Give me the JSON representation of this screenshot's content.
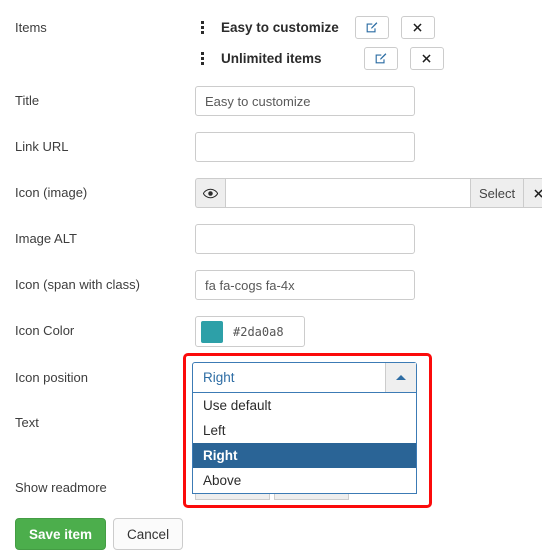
{
  "form": {
    "items": {
      "label": "Items",
      "rows": [
        {
          "title": "Easy to customize",
          "edit_icon": "pencil-square-icon",
          "delete_icon": "close-x-icon",
          "drag_icon": "drag-handle-icon"
        },
        {
          "title": "Unlimited items",
          "edit_icon": "pencil-square-icon",
          "delete_icon": "close-x-icon",
          "drag_icon": "drag-handle-icon"
        }
      ]
    },
    "title": {
      "label": "Title",
      "value": "Easy to customize",
      "placeholder": ""
    },
    "link_url": {
      "label": "Link URL",
      "value": "",
      "placeholder": ""
    },
    "icon_image": {
      "label": "Icon (image)",
      "value": "",
      "placeholder": "",
      "preview_icon": "eye-icon",
      "select_label": "Select",
      "clear_icon": "close-x-icon"
    },
    "image_alt": {
      "label": "Image ALT",
      "value": "",
      "placeholder": ""
    },
    "icon_span": {
      "label": "Icon (span with class)",
      "value": "fa fa-cogs fa-4x",
      "placeholder": ""
    },
    "icon_color": {
      "label": "Icon Color",
      "value": "#2da0a8",
      "swatch": "#2da0a8"
    },
    "icon_position": {
      "label": "Icon position",
      "selected": "Right",
      "toggle_icon": "caret-up-icon",
      "options": [
        {
          "label": "Use default",
          "selected": false
        },
        {
          "label": "Left",
          "selected": false
        },
        {
          "label": "Right",
          "selected": true
        },
        {
          "label": "Above",
          "selected": false
        }
      ]
    },
    "text": {
      "label": "Text"
    },
    "show_readmore": {
      "label": "Show readmore"
    }
  },
  "footer": {
    "save_label": "Save item",
    "cancel_label": "Cancel"
  },
  "highlight": {
    "color": "#fb0b0b"
  }
}
